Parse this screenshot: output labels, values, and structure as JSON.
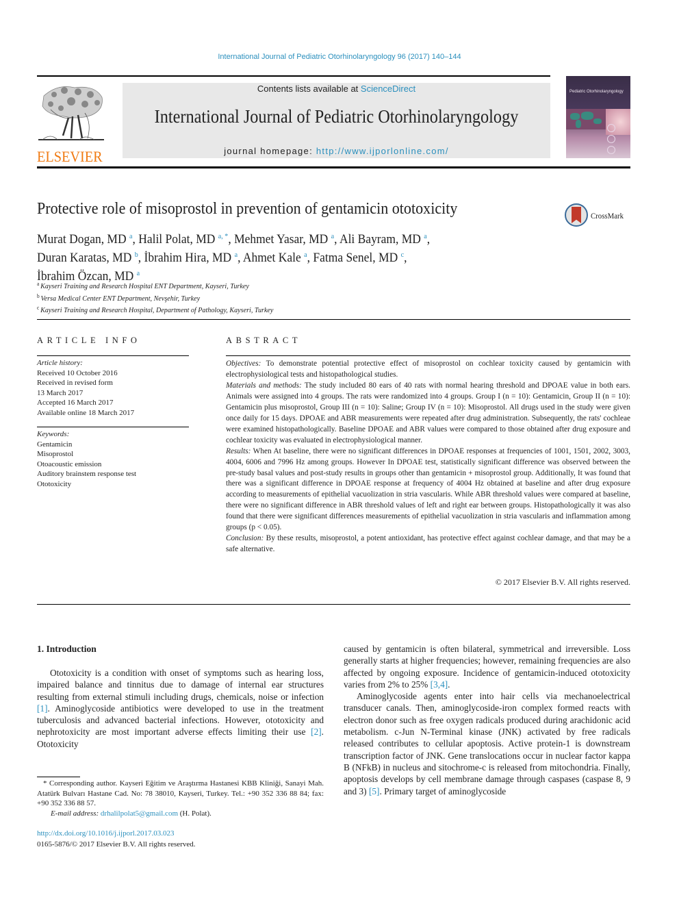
{
  "header": {
    "journal_reference": "International Journal of Pediatric Otorhinolaryngology 96 (2017) 140–144",
    "publisher_logo_text": "ELSEVIER",
    "contents_prefix": "Contents lists available at ",
    "contents_link": "ScienceDirect",
    "journal_title": "International Journal of Pediatric Otorhinolaryngology",
    "homepage_prefix": "journal homepage: ",
    "homepage_link": "http://www.ijporlonline.com/",
    "cover_title": "Pediatric Otorhinolaryngology"
  },
  "article": {
    "title": "Protective role of misoprostol in prevention of gentamicin ototoxicity",
    "crossmark_label": "CrossMark",
    "authors": [
      {
        "name": "Murat Dogan, MD",
        "sup": "a"
      },
      {
        "name": "Halil Polat, MD",
        "sup": "a, *"
      },
      {
        "name": "Mehmet Yasar, MD",
        "sup": "a"
      },
      {
        "name": "Ali Bayram, MD",
        "sup": "a"
      },
      {
        "name": "Duran Karatas, MD",
        "sup": "b"
      },
      {
        "name": "İbrahim Hira, MD",
        "sup": "a"
      },
      {
        "name": "Ahmet Kale",
        "sup": "a"
      },
      {
        "name": "Fatma Senel, MD",
        "sup": "c"
      },
      {
        "name": "İbrahim Özcan, MD",
        "sup": "a"
      }
    ],
    "affiliations": [
      {
        "key": "a",
        "text": "Kayseri Training and Research Hospital ENT Department, Kayseri, Turkey"
      },
      {
        "key": "b",
        "text": "Versa Medical Center ENT Department, Nevşehir, Turkey"
      },
      {
        "key": "c",
        "text": "Kayseri Training and Research Hospital, Department of Pathology, Kayseri, Turkey"
      }
    ]
  },
  "article_info": {
    "heading": "ARTICLE INFO",
    "history_label": "Article history:",
    "history": [
      "Received 10 October 2016",
      "Received in revised form",
      "13 March 2017",
      "Accepted 16 March 2017",
      "Available online 18 March 2017"
    ],
    "keywords_label": "Keywords:",
    "keywords": [
      "Gentamicin",
      "Misoprostol",
      "Otoacoustic emission",
      "Auditory brainstem response test",
      "Ototoxicity"
    ]
  },
  "abstract": {
    "heading": "ABSTRACT",
    "sections": [
      {
        "label": "Objectives:",
        "text": " To demonstrate potential protective effect of misoprostol on cochlear toxicity caused by gentamicin with electrophysiological tests and histopathological studies."
      },
      {
        "label": "Materials and methods:",
        "text": " The study included 80 ears of 40 rats with normal hearing threshold and DPOAE value in both ears. Animals were assigned into 4 groups. The rats were randomized into 4 groups. Group I (n = 10): Gentamicin, Group II (n = 10): Gentamicin plus misoprostol, Group III (n = 10): Saline; Group IV (n = 10): Misoprostol. All drugs used in the study were given once daily for 15 days. DPOAE and ABR measurements were repeated after drug administration. Subsequently, the rats' cochleae were examined histopathologically. Baseline DPOAE and ABR values were compared to those obtained after drug exposure and cochlear toxicity was evaluated in electrophysiological manner."
      },
      {
        "label": "Results:",
        "text": " When At baseline, there were no significant differences in DPOAE responses at frequencies of 1001, 1501, 2002, 3003, 4004, 6006 and 7996 Hz among groups. However In DPOAE test, statistically significant difference was observed between the pre-study basal values and post-study results in groups other than gentamicin + misoprostol group. Additionally, It was found that there was a significant difference in DPOAE response at frequency of 4004 Hz obtained at baseline and after drug exposure according to measurements of epithelial vacuolization in stria vascularis. While ABR threshold values were compared at baseline, there were no significant difference in ABR threshold values of left and right ear between groups. Histopathologically it was also found that there were significant differences measurements of epithelial vacuolization in stria vascularis and inflammation among groups (p < 0.05)."
      },
      {
        "label": "Conclusion:",
        "text": " By these results, misoprostol, a potent antioxidant, has protective effect against cochlear damage, and that may be a safe alternative."
      }
    ],
    "copyright": "© 2017 Elsevier B.V. All rights reserved."
  },
  "body": {
    "section_heading": "1.  Introduction",
    "left_paragraph": {
      "parts": [
        {
          "t": "Ototoxicity is a condition with onset of symptoms such as hearing loss, impaired balance and tinnitus due to damage of internal ear structures resulting from external stimuli including drugs, chemicals, noise or infection "
        },
        {
          "ref": "[1]"
        },
        {
          "t": ". Aminoglycoside antibiotics were developed to use in the treatment tuberculosis and advanced bacterial infections. However, ototoxicity and nephrotoxicity are most important adverse effects limiting their use "
        },
        {
          "ref": "[2]"
        },
        {
          "t": ". Ototoxicity"
        }
      ]
    },
    "right_paragraph_1": {
      "parts": [
        {
          "t": "caused by gentamicin is often bilateral, symmetrical and irreversible. Loss generally starts at higher frequencies; however, remaining frequencies are also affected by ongoing exposure. Incidence of gentamicin-induced ototoxicity varies from 2% to 25% "
        },
        {
          "ref": "[3,4]"
        },
        {
          "t": "."
        }
      ]
    },
    "right_paragraph_2": {
      "parts": [
        {
          "t": "Aminoglycoside agents enter into hair cells via mechanoelectrical transducer canals. Then, aminoglycoside-iron complex formed reacts with electron donor such as free oxygen radicals produced during arachidonic acid metabolism. c-Jun N-Terminal kinase (JNK) activated by free radicals released contributes to cellular apoptosis. Active protein-1 is downstream transcription factor of JNK. Gene translocations occur in nuclear factor kappa B (NFkB) in nucleus and sitochrome-c is released from mitochondria. Finally, apoptosis develops by cell membrane damage through caspases (caspase 8, 9 and 3) "
        },
        {
          "ref": "[5]"
        },
        {
          "t": ". Primary target of aminoglycoside"
        }
      ]
    }
  },
  "footnote": {
    "corresponding": "* Corresponding author. Kayseri Eğitim ve Araştırma Hastanesi KBB Kliniği, Sanayi Mah. Atatürk Bulvarı Hastane Cad. No: 78 38010, Kayseri, Turkey. Tel.: +90 352 336 88 84; fax: +90 352 336 88 57.",
    "email_label": "E-mail address:",
    "email": "drhalilpolat5@gmail.com",
    "email_suffix": " (H. Polat).",
    "doi": "http://dx.doi.org/10.1016/j.ijporl.2017.03.023",
    "issn_line": "0165-5876/© 2017 Elsevier B.V. All rights reserved."
  },
  "colors": {
    "link": "#2a8fbd",
    "elsevier_orange": "#f07a12",
    "banner_bg": "#e8e8e8"
  }
}
